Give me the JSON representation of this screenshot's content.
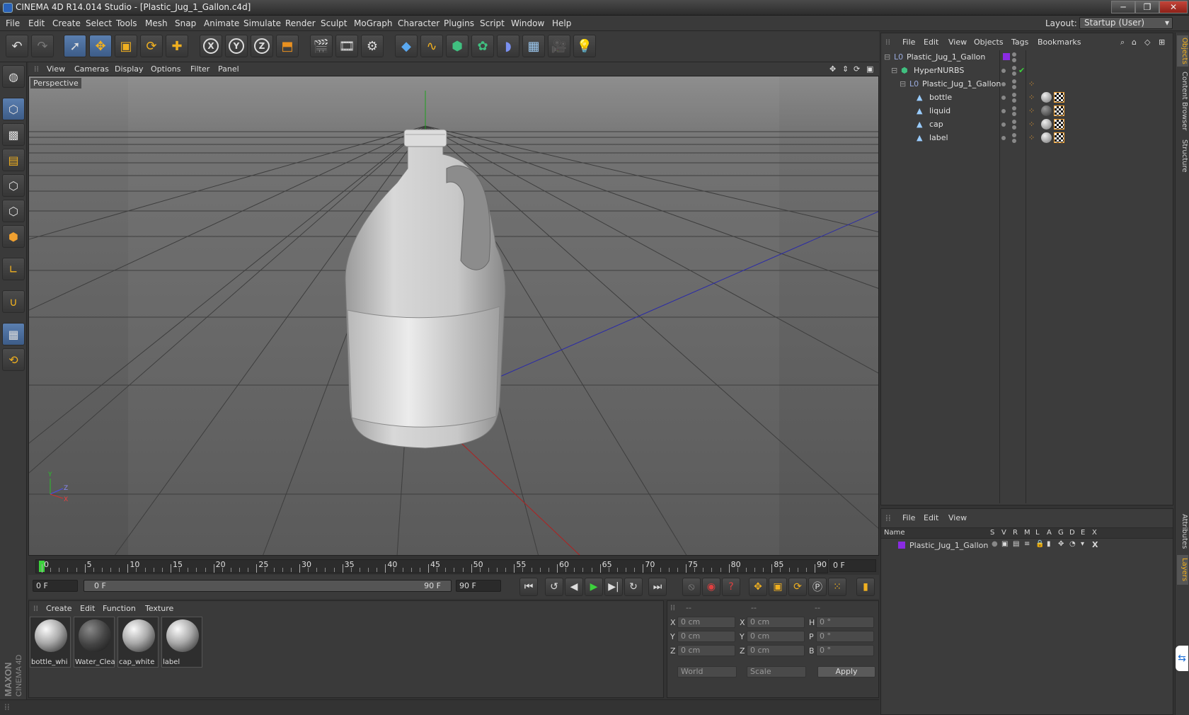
{
  "window": {
    "title": "CINEMA 4D R14.014 Studio - [Plastic_Jug_1_Gallon.c4d]",
    "min": "─",
    "max": "❐",
    "close": "✕"
  },
  "menu": [
    "File",
    "Edit",
    "Create",
    "Select",
    "Tools",
    "Mesh",
    "Snap",
    "Animate",
    "Simulate",
    "Render",
    "Sculpt",
    "MoGraph",
    "Character",
    "Plugins",
    "Script",
    "Window",
    "Help"
  ],
  "layout": {
    "label": "Layout:",
    "value": "Startup (User)"
  },
  "toolbar_icons": [
    "undo-icon",
    "redo-icon",
    "live-selection-icon",
    "move-icon",
    "scale-icon",
    "rotate-icon",
    "add-icon",
    "x-axis-icon",
    "y-axis-icon",
    "z-axis-icon",
    "coordinate-system-icon",
    "render-view-icon",
    "render-picture-viewer-icon",
    "render-settings-icon",
    "cube-icon",
    "spline-icon",
    "nurbs-icon",
    "array-icon",
    "deformer-icon",
    "floor-icon",
    "camera-icon",
    "light-icon"
  ],
  "axis_letters": {
    "x": "X",
    "y": "Y",
    "z": "Z"
  },
  "viewport": {
    "menu": [
      "View",
      "Cameras",
      "Display",
      "Options",
      "Filter",
      "Panel"
    ],
    "label": "Perspective"
  },
  "timeline": {
    "ticks": [
      "0",
      "5",
      "10",
      "15",
      "20",
      "25",
      "30",
      "35",
      "40",
      "45",
      "50",
      "55",
      "60",
      "65",
      "70",
      "75",
      "80",
      "85",
      "90"
    ],
    "current_frame": "0 F",
    "start": "0 F",
    "range_start": "0 F",
    "range_end": "90 F",
    "end": "90 F"
  },
  "materials": {
    "menu": [
      "Create",
      "Edit",
      "Function",
      "Texture"
    ],
    "items": [
      "bottle_whi",
      "Water_Clea",
      "cap_white",
      "label"
    ]
  },
  "coords": {
    "headers": [
      "--",
      "--",
      "--"
    ],
    "rows": [
      {
        "a": "X",
        "av": "0 cm",
        "b": "X",
        "bv": "0 cm",
        "c": "H",
        "cv": "0 °"
      },
      {
        "a": "Y",
        "av": "0 cm",
        "b": "Y",
        "bv": "0 cm",
        "c": "P",
        "cv": "0 °"
      },
      {
        "a": "Z",
        "av": "0 cm",
        "b": "Z",
        "bv": "0 cm",
        "c": "B",
        "cv": "0 °"
      }
    ],
    "world": "World",
    "scale": "Scale",
    "apply": "Apply"
  },
  "objects": {
    "menu": [
      "File",
      "Edit",
      "View",
      "Objects",
      "Tags",
      "Bookmarks"
    ],
    "rows": [
      "Plastic_Jug_1_Gallon",
      "HyperNURBS",
      "Plastic_Jug_1_Gallon",
      "bottle",
      "liquid",
      "cap",
      "label"
    ]
  },
  "layers": {
    "menu": [
      "File",
      "Edit",
      "View"
    ],
    "headers": [
      "Name",
      "S",
      "V",
      "R",
      "M",
      "L",
      "A",
      "G",
      "D",
      "E",
      "X"
    ],
    "rows": [
      "Plastic_Jug_1_Gallon"
    ],
    "layer_color": "#8a2be2"
  },
  "side_tabs": [
    "Objects",
    "Content Browser",
    "Structure",
    "Attributes",
    "Layers"
  ],
  "logo": {
    "brand": "MAXON",
    "product": "CINEMA 4D"
  }
}
